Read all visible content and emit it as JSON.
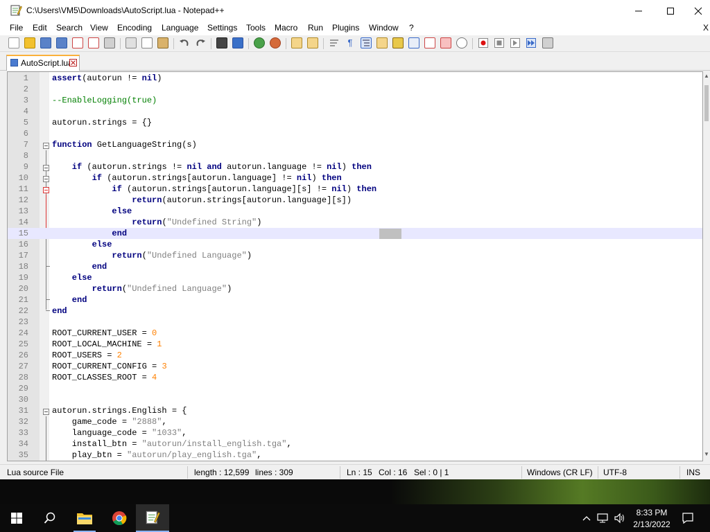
{
  "window": {
    "title": "C:\\Users\\VM5\\Downloads\\AutoScript.lua - Notepad++",
    "icon": "notepadpp-icon"
  },
  "menu": [
    "File",
    "Edit",
    "Search",
    "View",
    "Encoding",
    "Language",
    "Settings",
    "Tools",
    "Macro",
    "Run",
    "Plugins",
    "Window",
    "?"
  ],
  "menu_close_glyph": "X",
  "tab": {
    "label": "AutoScript.lua"
  },
  "code": {
    "lines": [
      {
        "n": "1"
      },
      {
        "n": "2"
      },
      {
        "n": "3"
      },
      {
        "n": "4"
      },
      {
        "n": "5"
      },
      {
        "n": "6"
      },
      {
        "n": "7"
      },
      {
        "n": "8"
      },
      {
        "n": "9"
      },
      {
        "n": "10"
      },
      {
        "n": "11"
      },
      {
        "n": "12"
      },
      {
        "n": "13"
      },
      {
        "n": "14"
      },
      {
        "n": "15"
      },
      {
        "n": "16"
      },
      {
        "n": "17"
      },
      {
        "n": "18"
      },
      {
        "n": "19"
      },
      {
        "n": "20"
      },
      {
        "n": "21"
      },
      {
        "n": "22"
      },
      {
        "n": "23"
      },
      {
        "n": "24"
      },
      {
        "n": "25"
      },
      {
        "n": "26"
      },
      {
        "n": "27"
      },
      {
        "n": "28"
      },
      {
        "n": "29"
      },
      {
        "n": "30"
      },
      {
        "n": "31"
      },
      {
        "n": "32"
      },
      {
        "n": "33"
      },
      {
        "n": "34"
      },
      {
        "n": "35"
      }
    ],
    "text": {
      "l1a": "assert",
      "l1b": "(autorun != ",
      "l1c": "nil",
      "l1d": ")",
      "l3": "--EnableLogging(true)",
      "l5": "autorun.strings = {}",
      "l7a": "function",
      "l7b": " GetLanguageString(s)",
      "l9a": "    if",
      "l9b": " (autorun.strings != ",
      "l9c": "nil",
      "l9d": " ",
      "l9e": "and",
      "l9f": " autorun.language != ",
      "l9g": "nil",
      "l9h": ") ",
      "l9i": "then",
      "l10a": "        if",
      "l10b": " (autorun.strings[autorun.language] != ",
      "l10c": "nil",
      "l10d": ") ",
      "l10e": "then",
      "l11a": "            if",
      "l11b": " (autorun.strings[autorun.language][s] != ",
      "l11c": "nil",
      "l11d": ") ",
      "l11e": "then",
      "l12a": "                return",
      "l12b": "(autorun.strings[autorun.language][s])",
      "l13": "            else",
      "l14a": "                return",
      "l14b": "(",
      "l14c": "\"Undefined String\"",
      "l14d": ")",
      "l15": "            end",
      "l16": "        else",
      "l17a": "            return",
      "l17b": "(",
      "l17c": "\"Undefined Language\"",
      "l17d": ")",
      "l18": "        end",
      "l19": "    else",
      "l20a": "        return",
      "l20b": "(",
      "l20c": "\"Undefined Language\"",
      "l20d": ")",
      "l21": "    end",
      "l22": "end",
      "l24a": "ROOT_CURRENT_USER = ",
      "l24b": "0",
      "l25a": "ROOT_LOCAL_MACHINE = ",
      "l25b": "1",
      "l26a": "ROOT_USERS = ",
      "l26b": "2",
      "l27a": "ROOT_CURRENT_CONFIG = ",
      "l27b": "3",
      "l28a": "ROOT_CLASSES_ROOT = ",
      "l28b": "4",
      "l31": "autorun.strings.English = {",
      "l32a": "    game_code = ",
      "l32b": "\"2888\"",
      "l32c": ",",
      "l33a": "    language_code = ",
      "l33b": "\"1033\"",
      "l33c": ",",
      "l34a": "    install_btn = ",
      "l34b": "\"autorun/install_english.tga\"",
      "l34c": ",",
      "l35a": "    play_btn = ",
      "l35b": "\"autorun/play_english.tga\"",
      "l35c": ","
    },
    "current_line": "15"
  },
  "status": {
    "filetype": "Lua source File",
    "length": "length : 12,599",
    "lines": "lines : 309",
    "ln": "Ln : 15",
    "col": "Col : 16",
    "sel": "Sel : 0 | 1",
    "eol": "Windows (CR LF)",
    "encoding": "UTF-8",
    "mode": "INS"
  },
  "taskbar": {
    "time": "8:33 PM",
    "date": "2/13/2022",
    "apps": [
      "start-icon",
      "search-icon",
      "file-explorer-icon",
      "chrome-icon",
      "notepadpp-icon"
    ]
  },
  "colors": {
    "keyword": "#00007f",
    "comment": "#007f00",
    "string": "#7f7f7f",
    "number": "#ff8000",
    "current_line_bg": "#e8e8ff",
    "tab_accent": "#fbb03b"
  }
}
